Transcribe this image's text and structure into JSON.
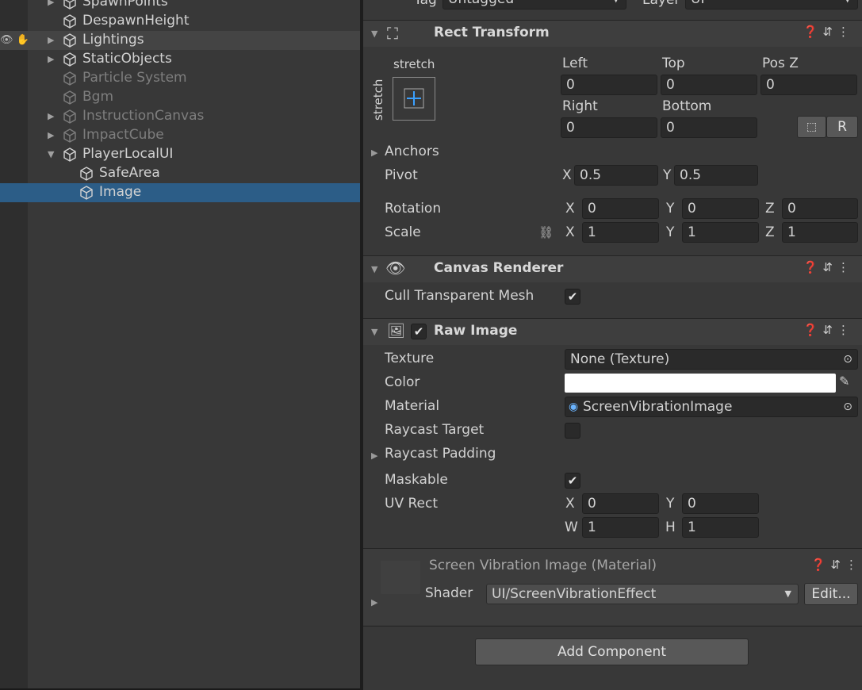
{
  "hierarchy": {
    "items": [
      {
        "label": "SpawnPoints",
        "arrow": "▶"
      },
      {
        "label": "DespawnHeight",
        "arrow": ""
      },
      {
        "label": "Lightings",
        "arrow": "▶"
      },
      {
        "label": "StaticObjects",
        "arrow": "▶"
      },
      {
        "label": "Particle System",
        "arrow": ""
      },
      {
        "label": "Bgm",
        "arrow": ""
      },
      {
        "label": "InstructionCanvas",
        "arrow": "▶"
      },
      {
        "label": "ImpactCube",
        "arrow": "▶"
      },
      {
        "label": "PlayerLocalUI",
        "arrow": "▼"
      },
      {
        "label": "SafeArea",
        "arrow": ""
      },
      {
        "label": "Image",
        "arrow": ""
      }
    ]
  },
  "top": {
    "tag_label": "Tag",
    "tag_value": "Untagged",
    "layer_label": "Layer",
    "layer_value": "UI"
  },
  "rect_transform": {
    "title": "Rect Transform",
    "anchor_h": "stretch",
    "anchor_v": "stretch",
    "left_label": "Left",
    "top_label": "Top",
    "posz_label": "Pos Z",
    "left": "0",
    "top": "0",
    "posz": "0",
    "right_label": "Right",
    "bottom_label": "Bottom",
    "right": "0",
    "bottom": "0",
    "raw_label": "R",
    "anchors_label": "Anchors",
    "pivot_label": "Pivot",
    "pivot_x": "0.5",
    "pivot_y": "0.5",
    "rotation_label": "Rotation",
    "rot_x": "0",
    "rot_y": "0",
    "rot_z": "0",
    "scale_label": "Scale",
    "scale_x": "1",
    "scale_y": "1",
    "scale_z": "1",
    "axis_x": "X",
    "axis_y": "Y",
    "axis_z": "Z"
  },
  "canvas_renderer": {
    "title": "Canvas Renderer",
    "cull_label": "Cull Transparent Mesh",
    "check": "✔"
  },
  "raw_image": {
    "title": "Raw Image",
    "texture_label": "Texture",
    "texture_value": "None (Texture)",
    "color_label": "Color",
    "color_value": "#ffffff",
    "material_label": "Material",
    "material_value": "ScreenVibrationImage",
    "raycast_target_label": "Raycast Target",
    "raycast_padding_label": "Raycast Padding",
    "maskable_label": "Maskable",
    "uvrect_label": "UV Rect",
    "uv_x": "0",
    "uv_y": "0",
    "uv_w": "1",
    "uv_h": "1",
    "axis_w": "W",
    "axis_h": "H"
  },
  "material": {
    "title": "Screen Vibration Image (Material)",
    "shader_label": "Shader",
    "shader_value": "UI/ScreenVibrationEffect",
    "edit_label": "Edit..."
  },
  "add_component": {
    "label": "Add Component"
  },
  "colors": {
    "selection": "#2c5d87",
    "panel": "#383838",
    "header": "#3e3e3e",
    "field": "#2a2a2a"
  }
}
